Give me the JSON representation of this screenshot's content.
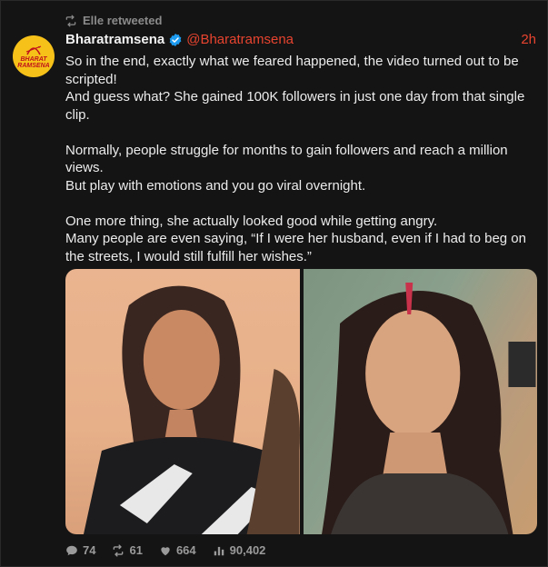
{
  "retweet": {
    "label": "Elle retweeted"
  },
  "author": {
    "name": "Bharatramsena",
    "handle": "@Bharatramsena",
    "avatar_text": [
      "BHARAT",
      "RAMSENA"
    ]
  },
  "time": "2h",
  "tweet_paragraphs": [
    "So in the end, exactly what we feared happened, the video turned out to be scripted!",
    "And guess what? She gained 100K followers in just one day from that single clip.",
    "",
    "Normally, people struggle for months to gain followers and reach a million views.",
    "But play with emotions and you go viral overnight.",
    "",
    "One more thing, she actually looked good while getting angry.",
    "Many people are even saying, “If I were her husband, even if I had to beg on the streets, I would still fulfill her wishes.”"
  ],
  "media": [
    {
      "name": "photo-left",
      "description_icon": "photo"
    },
    {
      "name": "photo-right",
      "description_icon": "photo"
    }
  ],
  "stats": {
    "replies": "74",
    "retweets": "61",
    "likes": "664",
    "views": "90,402"
  },
  "colors": {
    "background": "#141414",
    "accent": "#e8442f",
    "verified": "#1d9bf0",
    "muted": "#8b8b8b"
  }
}
